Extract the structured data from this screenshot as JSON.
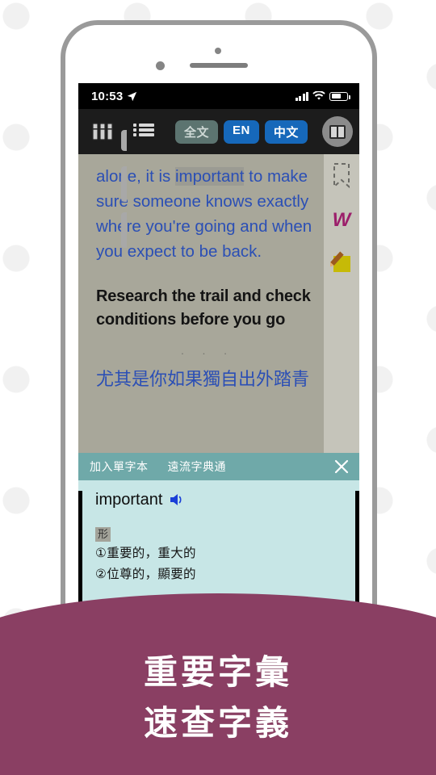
{
  "phone": {
    "status_bar": {
      "time": "10:53",
      "location_icon": "location-arrow-icon",
      "signal_icon": "cellular-signal-icon",
      "wifi_icon": "wifi-icon",
      "battery_icon": "battery-icon"
    },
    "toolbar": {
      "bookshelf_icon": "bookshelf-icon",
      "toc_icon": "table-of-contents-icon",
      "segments": [
        {
          "label": "全文",
          "state": "inactive",
          "color": "#5c7470"
        },
        {
          "label": "EN",
          "state": "active",
          "color": "#1668ba"
        },
        {
          "label": "中文",
          "state": "active",
          "color": "#1668ba"
        }
      ],
      "layout_icon": "two-column-layout-icon"
    },
    "reader": {
      "paragraph_before": "alone, it is ",
      "highlighted_word": "important",
      "paragraph_after": " to make sure someone knows exactly where you're going and when you expect to be back.",
      "heading": "Research the trail and check conditions before you go",
      "separator": "· · ·",
      "chinese_line": "尤其是你如果獨自出外踏青",
      "text_color": "#2b4fb5",
      "bg_color": "#a8a79a",
      "highlight_color": "#9b9b93"
    },
    "tool_rail": {
      "bookmark_icon": "bookmark-outline-icon",
      "word_icon": "word-lookup-icon",
      "word_label": "W",
      "note_icon": "sticky-note-pencil-icon"
    },
    "dictionary": {
      "add_to_wordbook": "加入單字本",
      "dictionary_name": "遠流字典通",
      "close_icon": "close-icon",
      "word": "important",
      "speaker_icon": "speaker-icon",
      "part_of_speech": "形",
      "definitions": [
        "①重要的，重大的",
        "②位尊的，顯要的"
      ],
      "header_color": "#6fa9a9",
      "body_color": "#c7e6e6"
    }
  },
  "banner": {
    "line1": "重要字彙",
    "line2": "速查字義",
    "bg_color": "#8a3f63",
    "text_color": "#ffffff"
  }
}
